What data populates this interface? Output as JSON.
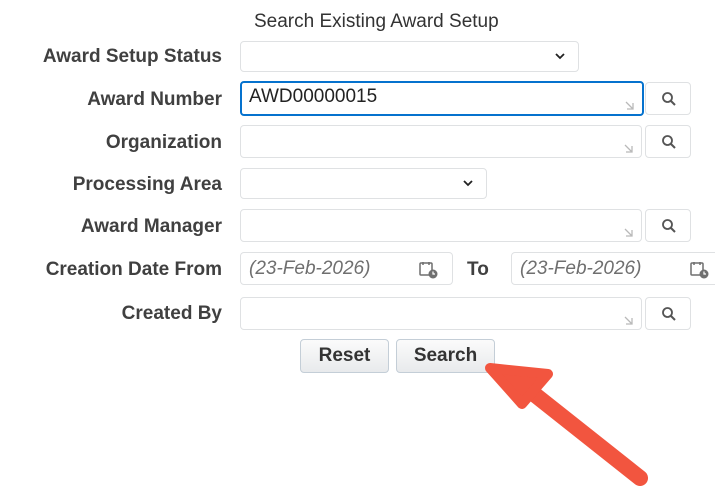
{
  "form": {
    "title": "Search Existing Award Setup",
    "fields": {
      "award_setup_status": {
        "label": "Award Setup Status",
        "value": ""
      },
      "award_number": {
        "label": "Award Number",
        "value": "AWD00000015"
      },
      "organization": {
        "label": "Organization",
        "value": ""
      },
      "processing_area": {
        "label": "Processing Area",
        "value": ""
      },
      "award_manager": {
        "label": "Award Manager",
        "value": ""
      },
      "creation_date_from": {
        "label": "Creation Date From",
        "placeholder": "(23-Feb-2026)"
      },
      "creation_date_to": {
        "label": "To",
        "placeholder": "(23-Feb-2026)"
      },
      "created_by": {
        "label": "Created By",
        "value": ""
      }
    },
    "buttons": {
      "reset": "Reset",
      "search": "Search"
    }
  },
  "colors": {
    "focus_border": "#0572ce",
    "annotation_arrow": "#f2553f"
  },
  "icons": [
    "chevron-down-icon",
    "search-icon",
    "resize-corner-icon",
    "calendar-icon"
  ]
}
